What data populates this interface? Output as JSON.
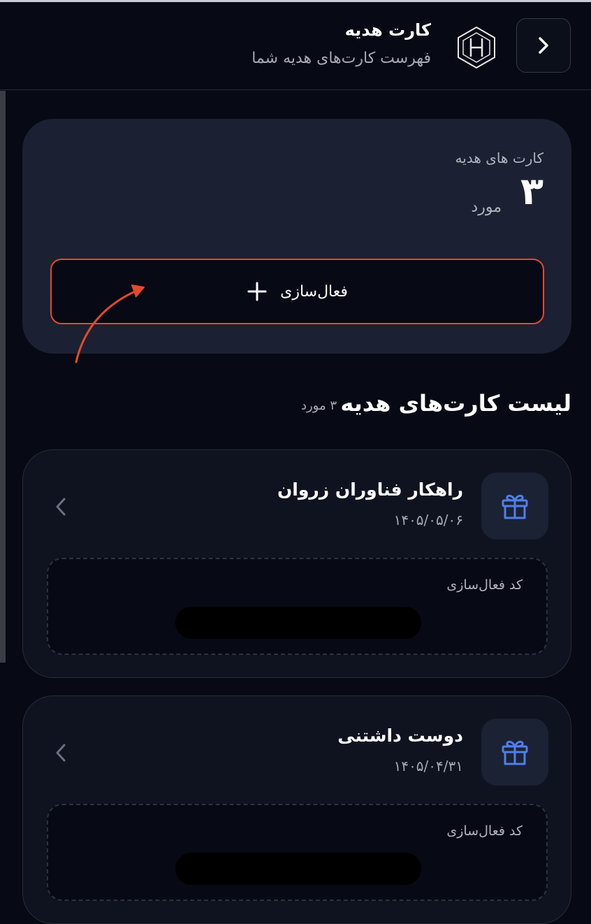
{
  "header": {
    "title": "کارت هدیه",
    "subtitle": "فهرست کارت‌های هدیه شما",
    "back_icon": "chevron-right-icon",
    "logo_icon": "hexagon-h-logo"
  },
  "summary": {
    "label": "کارت های هدیه",
    "count": "۳",
    "unit": "مورد",
    "activate_label": "فعال‌سازی",
    "activate_icon": "plus-icon"
  },
  "gift_list": {
    "title": "لیست کارت‌های هدیه",
    "count_text": "۳ مورد",
    "items": [
      {
        "name": "راهکار فناوران زروان",
        "date": "۱۴۰۵/۰۵/۰۶",
        "code_label": "کد فعال‌سازی",
        "icon": "gift-icon"
      },
      {
        "name": "دوست داشتنی",
        "date": "۱۴۰۵/۰۴/۳۱",
        "code_label": "کد فعال‌سازی",
        "icon": "gift-icon"
      }
    ]
  },
  "colors": {
    "background": "#070a14",
    "card": "#1b2132",
    "accent_border": "#e24a2c",
    "gift_icon": "#4f7fea"
  }
}
